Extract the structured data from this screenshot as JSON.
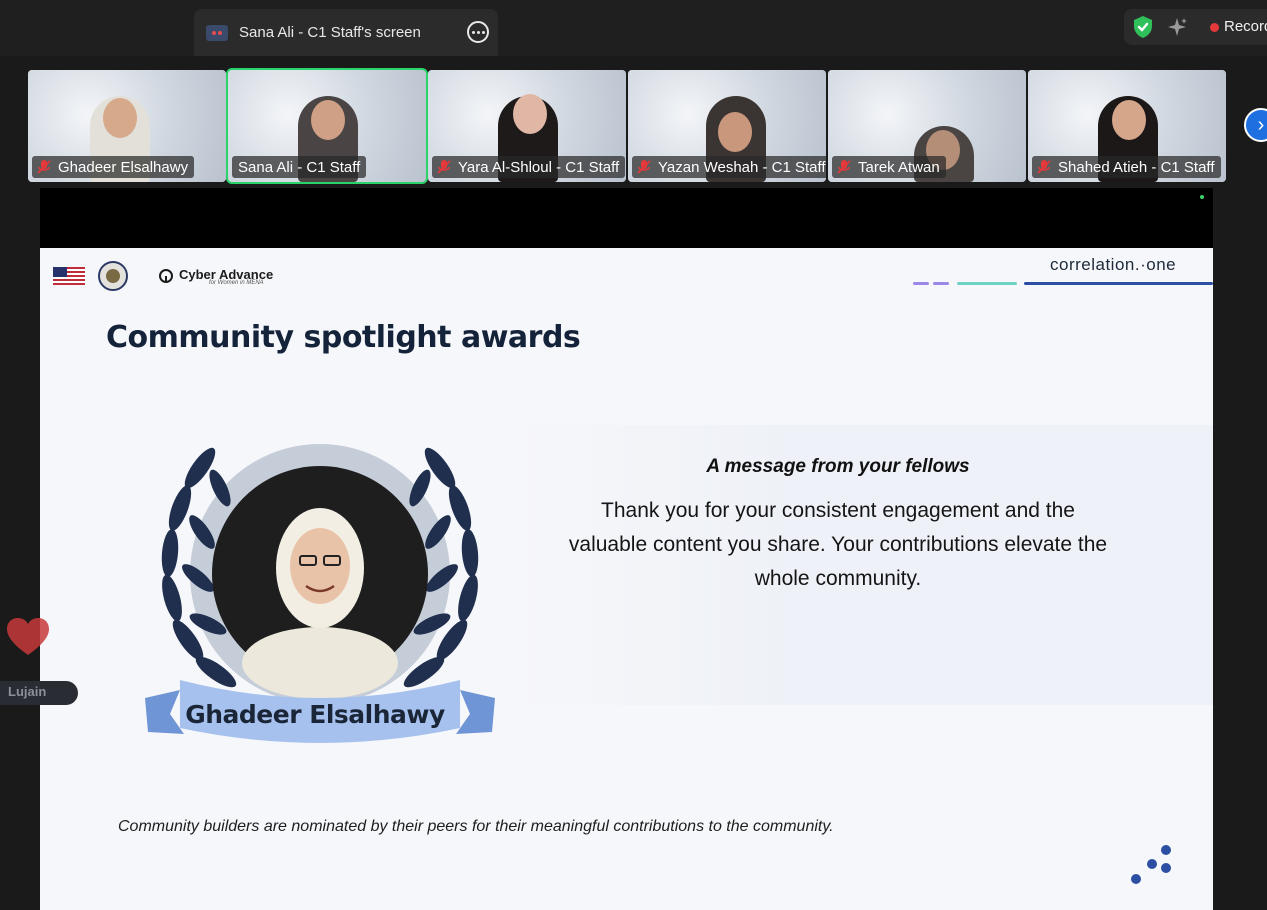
{
  "share_tab": {
    "title": "Sana Ali - C1 Staff's screen"
  },
  "top_right": {
    "record_label": "Recording"
  },
  "participants": [
    {
      "name": "Ghadeer Elsalhawy"
    },
    {
      "name": "Sana Ali - C1 Staff"
    },
    {
      "name": "Yara Al-Shloul - C1 Staff"
    },
    {
      "name": "Yazan Weshah - C1 Staff"
    },
    {
      "name": "Tarek Atwan"
    },
    {
      "name": "Shahed Atieh - C1 Staff"
    }
  ],
  "slide": {
    "brand": {
      "title": "Cyber Advance",
      "subtitle": "for Women in MENA",
      "partner": "correlation.·one"
    },
    "title": "Community spotlight awards",
    "message_heading": "A message from your fellows",
    "message_body": "Thank you for your consistent engagement and the valuable content you share. Your contributions elevate the whole community.",
    "honoree": "Ghadeer Elsalhawy",
    "footnote": "Community builders are nominated by their peers for their meaningful contributions to the community."
  },
  "reaction": {
    "name": "Lujain"
  },
  "colors": {
    "active_speaker": "#2bd46a",
    "slide_navy": "#14233a",
    "ribbon": "#8fb0e8",
    "laurel": "#1f2f4d",
    "record": "#e5383b"
  }
}
